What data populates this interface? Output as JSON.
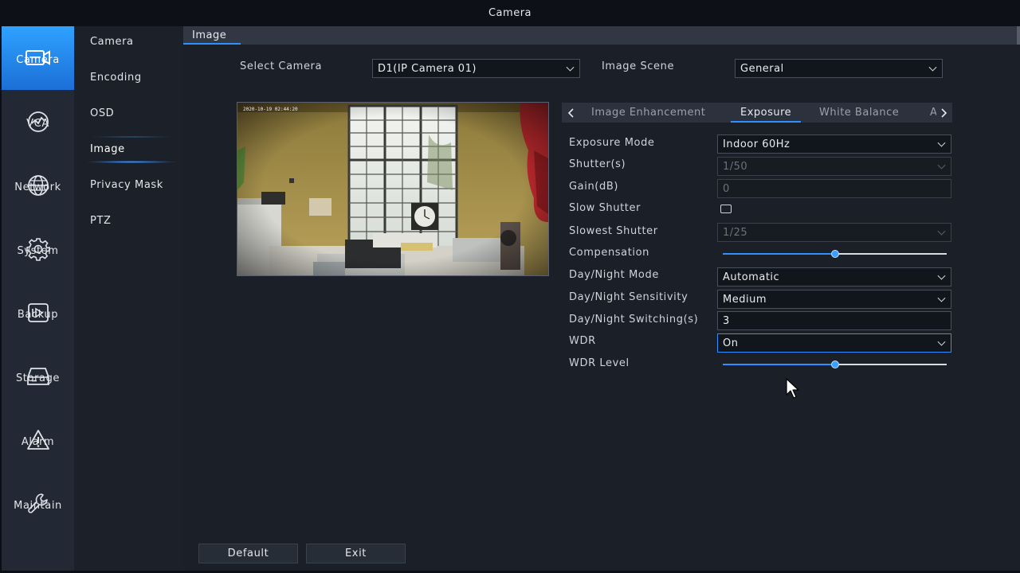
{
  "window": {
    "title": "Camera"
  },
  "nav": {
    "items": [
      {
        "label": "Camera",
        "icon": "camera-icon"
      },
      {
        "label": "VCA",
        "icon": "vca-icon"
      },
      {
        "label": "Network",
        "icon": "globe-icon"
      },
      {
        "label": "System",
        "icon": "gear-icon"
      },
      {
        "label": "Backup",
        "icon": "backup-icon"
      },
      {
        "label": "Storage",
        "icon": "storage-icon"
      },
      {
        "label": "Alarm",
        "icon": "alarm-icon"
      },
      {
        "label": "Maintain",
        "icon": "wrench-icon"
      }
    ],
    "active": "Camera"
  },
  "subnav": {
    "items": [
      "Camera",
      "Encoding",
      "OSD",
      "Image",
      "Privacy Mask",
      "PTZ"
    ],
    "active": "Image"
  },
  "tab": {
    "label": "Image"
  },
  "top": {
    "select_camera_label": "Select Camera",
    "select_camera_value": "D1(IP Camera 01)",
    "image_scene_label": "Image Scene",
    "image_scene_value": "General"
  },
  "preview": {
    "timestamp": "2020-10-19 02:44:20"
  },
  "param_tabs": {
    "items": [
      "Image Enhancement",
      "Exposure",
      "White Balance",
      "A"
    ],
    "active": "Exposure"
  },
  "form": {
    "exposure_mode": {
      "label": "Exposure Mode",
      "value": "Indoor 60Hz"
    },
    "shutter": {
      "label": "Shutter(s)",
      "value": "1/50"
    },
    "gain": {
      "label": "Gain(dB)",
      "value": "0"
    },
    "slow_shutter": {
      "label": "Slow Shutter",
      "checked": false
    },
    "slowest_shutter": {
      "label": "Slowest Shutter",
      "value": "1/25"
    },
    "compensation": {
      "label": "Compensation",
      "level": 0.5
    },
    "day_night_mode": {
      "label": "Day/Night Mode",
      "value": "Automatic"
    },
    "day_night_sensitivity": {
      "label": "Day/Night Sensitivity",
      "value": "Medium"
    },
    "day_night_switching": {
      "label": "Day/Night Switching(s)",
      "value": "3"
    },
    "wdr": {
      "label": "WDR",
      "value": "On"
    },
    "wdr_level": {
      "label": "WDR Level",
      "level": 0.5
    }
  },
  "buttons": {
    "default": "Default",
    "exit": "Exit"
  },
  "colors": {
    "accent": "#2f8fff",
    "nav_active": "#2fa2ff",
    "background": "#1a1f28"
  }
}
